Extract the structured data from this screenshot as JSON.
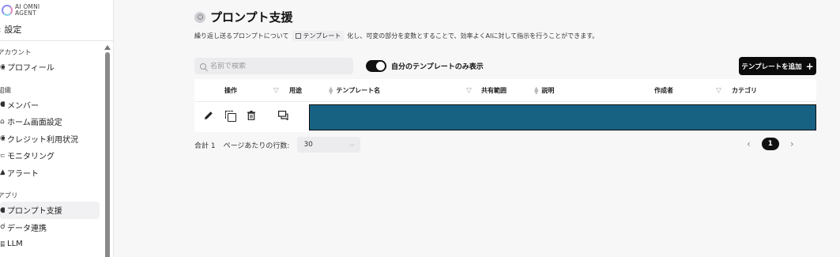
{
  "sidebar": {
    "logo_line1": "AI OMNI",
    "logo_line2": "AGENT",
    "back_label": "設定",
    "sections": [
      {
        "title": "アカウント",
        "items": [
          {
            "label": "プロフィール"
          }
        ]
      },
      {
        "title": "組織",
        "items": [
          {
            "label": "メンバー"
          },
          {
            "label": "ホーム画面設定"
          },
          {
            "label": "クレジット利用状況"
          },
          {
            "label": "モニタリング"
          },
          {
            "label": "アラート"
          }
        ]
      },
      {
        "title": "アプリ",
        "items": [
          {
            "label": "プロンプト支援",
            "active": true
          },
          {
            "label": "データ連携"
          },
          {
            "label": "LLM"
          }
        ]
      }
    ]
  },
  "page": {
    "title": "プロンプト支援",
    "desc_prefix": "繰り返し送るプロンプトについて",
    "desc_chip": "テンプレート",
    "desc_suffix": "化し、可変の部分を変数とすることで、効率よくAIに対して指示を行うことができます。"
  },
  "toolbar": {
    "search_placeholder": "名前で検索",
    "toggle_label": "自分のテンプレートのみ表示",
    "toggle_on": true,
    "add_button_label": "テンプレートを追加"
  },
  "table": {
    "columns": [
      "操作",
      "用途",
      "テンプレート名",
      "共有範囲",
      "説明",
      "作成者",
      "カテゴリ"
    ],
    "row_highlight_color": "#176182"
  },
  "footer": {
    "total_label": "合計 1",
    "rows_per_page_label": "ページあたりの行数:",
    "rows_per_page_value": "30",
    "current_page": "1"
  }
}
